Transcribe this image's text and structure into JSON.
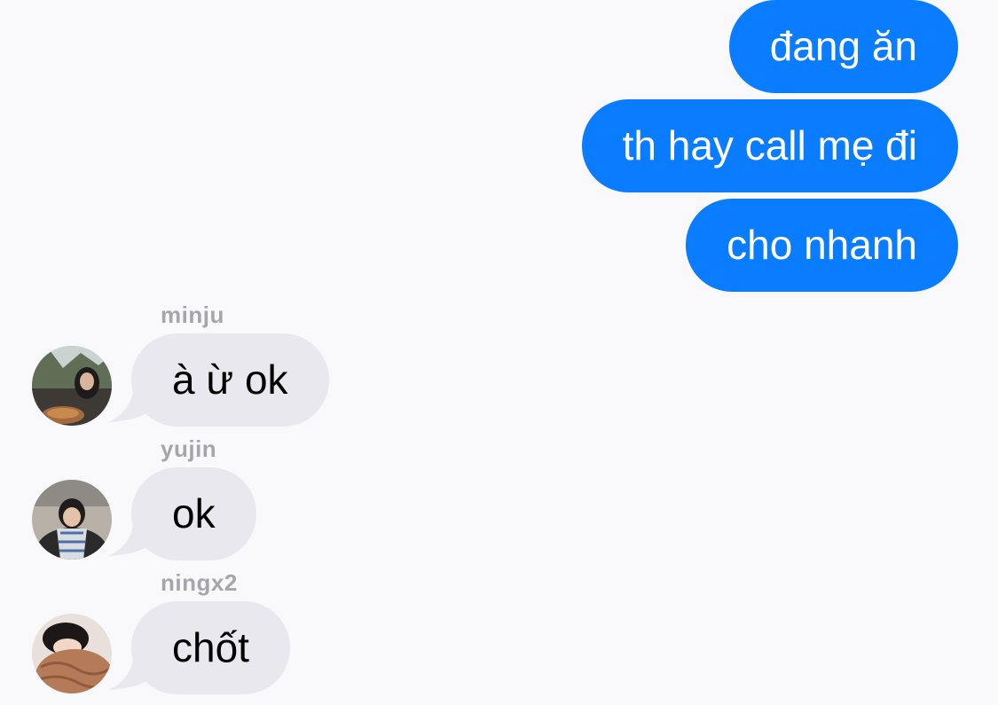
{
  "colors": {
    "background": "#f9f9fb",
    "outgoing_bubble": "#0a7cff",
    "incoming_bubble": "#e9e8ee",
    "sender_name": "#a5a5ab"
  },
  "outgoing": [
    {
      "text": "đang ăn"
    },
    {
      "text": "th hay call mẹ đi"
    },
    {
      "text": "cho nhanh"
    }
  ],
  "incoming": [
    {
      "sender": "minju",
      "text": "à ừ ok",
      "avatar_icon": "user-photo-icon"
    },
    {
      "sender": "yujin",
      "text": "ok",
      "avatar_icon": "user-photo-icon"
    },
    {
      "sender": "ningx2",
      "text": "chốt",
      "avatar_icon": "user-photo-icon"
    }
  ]
}
